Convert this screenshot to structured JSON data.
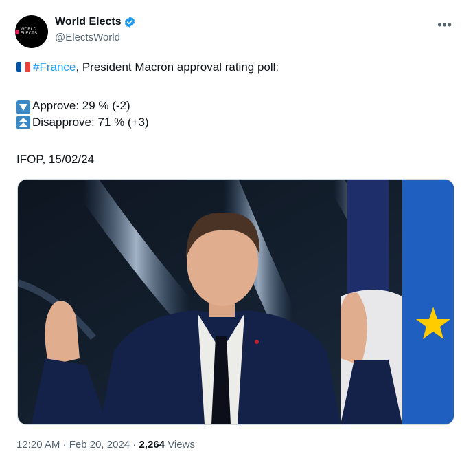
{
  "author": {
    "display_name": "World Elects",
    "handle": "@ElectsWorld",
    "avatar_logo_text": "WORLD ELECTS",
    "verified_color": "#1d9bf0"
  },
  "menu": {
    "more_label": "•••"
  },
  "tweet": {
    "hashtag": "#France",
    "headline_rest": ", President Macron approval rating poll:",
    "approve_line": "Approve: 29 % (-2)",
    "disapprove_line": "Disapprove: 71 % (+3)",
    "source_line": "IFOP, 15/02/24"
  },
  "icons": {
    "flag": "france-flag-icon",
    "down": "down-arrow-box-icon",
    "up": "double-up-arrow-box-icon"
  },
  "footer": {
    "time": "12:20 AM",
    "separator": " · ",
    "date": "Feb 20, 2024",
    "views_count": "2,264",
    "views_label": "Views"
  }
}
